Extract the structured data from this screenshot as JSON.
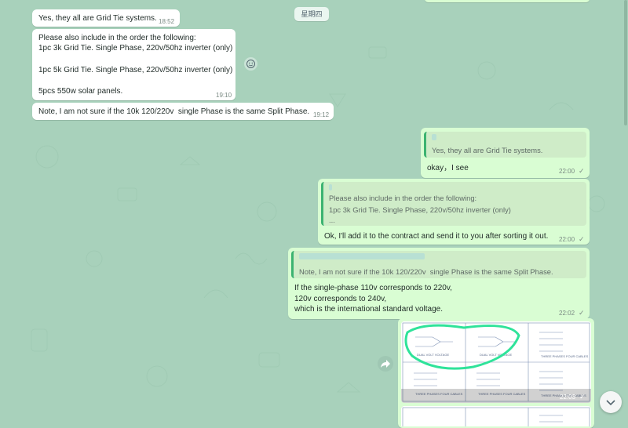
{
  "date_separator": "星期四",
  "incoming": [
    {
      "lines": [
        "Yes, they all are Grid Tie systems."
      ],
      "time": "18:52"
    },
    {
      "lines": [
        "Please also include in the order the following:",
        "1pc 3k Grid Tie. Single Phase, 220v/50hz inverter (only)",
        "",
        "1pc 5k Grid Tie. Single Phase, 220v/50hz inverter (only)",
        "",
        "5pcs 550w solar panels."
      ],
      "time": "19:10"
    },
    {
      "lines": [
        "Note, I am not sure if the 10k 120/220v  single Phase is the same Split Phase."
      ],
      "time": "19:12"
    }
  ],
  "outgoing": [
    {
      "quote_lines": [
        "Yes, they all are Grid Tie systems."
      ],
      "lines": [
        "okay，I see"
      ],
      "time": "22:00"
    },
    {
      "quote_lines": [
        "Please also include in the order the following:",
        "1pc 3k Grid Tie. Single Phase, 220v/50hz inverter (only)",
        "..."
      ],
      "lines": [
        "Ok, I'll add it to the contract and send it to you after sorting it out."
      ],
      "time": "22:00"
    },
    {
      "quote_lines": [
        "Note, I am not sure if the 10k 120/220v  single Phase is the same Split Phase."
      ],
      "lines": [
        "If the single-phase 110v corresponds to 220v,",
        "120v corresponds to 240v,",
        "which is the international standard voltage."
      ],
      "time": "22:02"
    }
  ],
  "image_message": {
    "time": "22:03",
    "cells": [
      "DUAL VOLT VOLTAGE",
      "DUAL VOLT VOLTAGE",
      "THREE PHASES FOUR CABLES",
      "THREE PHASES FOUR CABLES",
      "THREE PHASES FOUR CABLES",
      "THREE PHASES FIVE CABLES"
    ]
  },
  "icons": {
    "reaction": "smiley-icon",
    "forward": "forward-icon",
    "scroll_down": "chevron-down-icon",
    "delivered": "check-icon"
  },
  "colors": {
    "wallpaper": "#a8d1bb",
    "incoming": "#ffffff",
    "outgoing": "#d9fdd3",
    "quote_bar": "#3cb371",
    "highlight": "#2fe39a"
  }
}
